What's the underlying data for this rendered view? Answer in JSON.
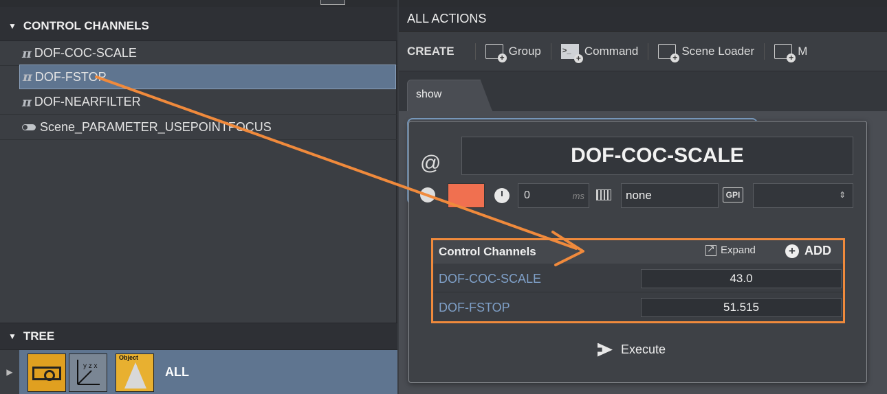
{
  "left_panel": {
    "control_channels_header": "CONTROL CHANNELS",
    "channels": [
      {
        "label": "DOF-COC-SCALE",
        "icon": "pi-icon"
      },
      {
        "label": "DOF-FSTOP",
        "icon": "pi-icon",
        "selected": true
      },
      {
        "label": "DOF-NEARFILTER",
        "icon": "pi-icon"
      },
      {
        "label": "Scene_PARAMETER_USEPOINTFOCUS",
        "icon": "toggle-icon"
      }
    ],
    "tree_header": "TREE",
    "tree_item_label": "ALL",
    "tree_axis_glyph": "y z x",
    "tree_object_badge": "Object"
  },
  "right_panel": {
    "header": "ALL ACTIONS",
    "create_label": "CREATE",
    "create_buttons": [
      "Group",
      "Command",
      "Scene Loader",
      "M"
    ],
    "tabs": [
      "show"
    ]
  },
  "dialog": {
    "at_glyph": "@",
    "action_name": "DOF-COC-SCALE",
    "color": "#f07050",
    "delay_value": "0",
    "delay_unit": "ms",
    "key_value": "none",
    "gpi_label": "GPI",
    "gpi_value": "",
    "control_channels": {
      "title": "Control Channels",
      "expand_label": "Expand",
      "add_label": "ADD",
      "rows": [
        {
          "name": "DOF-COC-SCALE",
          "value": "43.0"
        },
        {
          "name": "DOF-FSTOP",
          "value": "51.515"
        }
      ]
    },
    "execute_label": "Execute"
  },
  "colors": {
    "accent_orange": "#f08a3c",
    "selection_blue": "#5f7590",
    "link_blue": "#7fa0c8"
  }
}
